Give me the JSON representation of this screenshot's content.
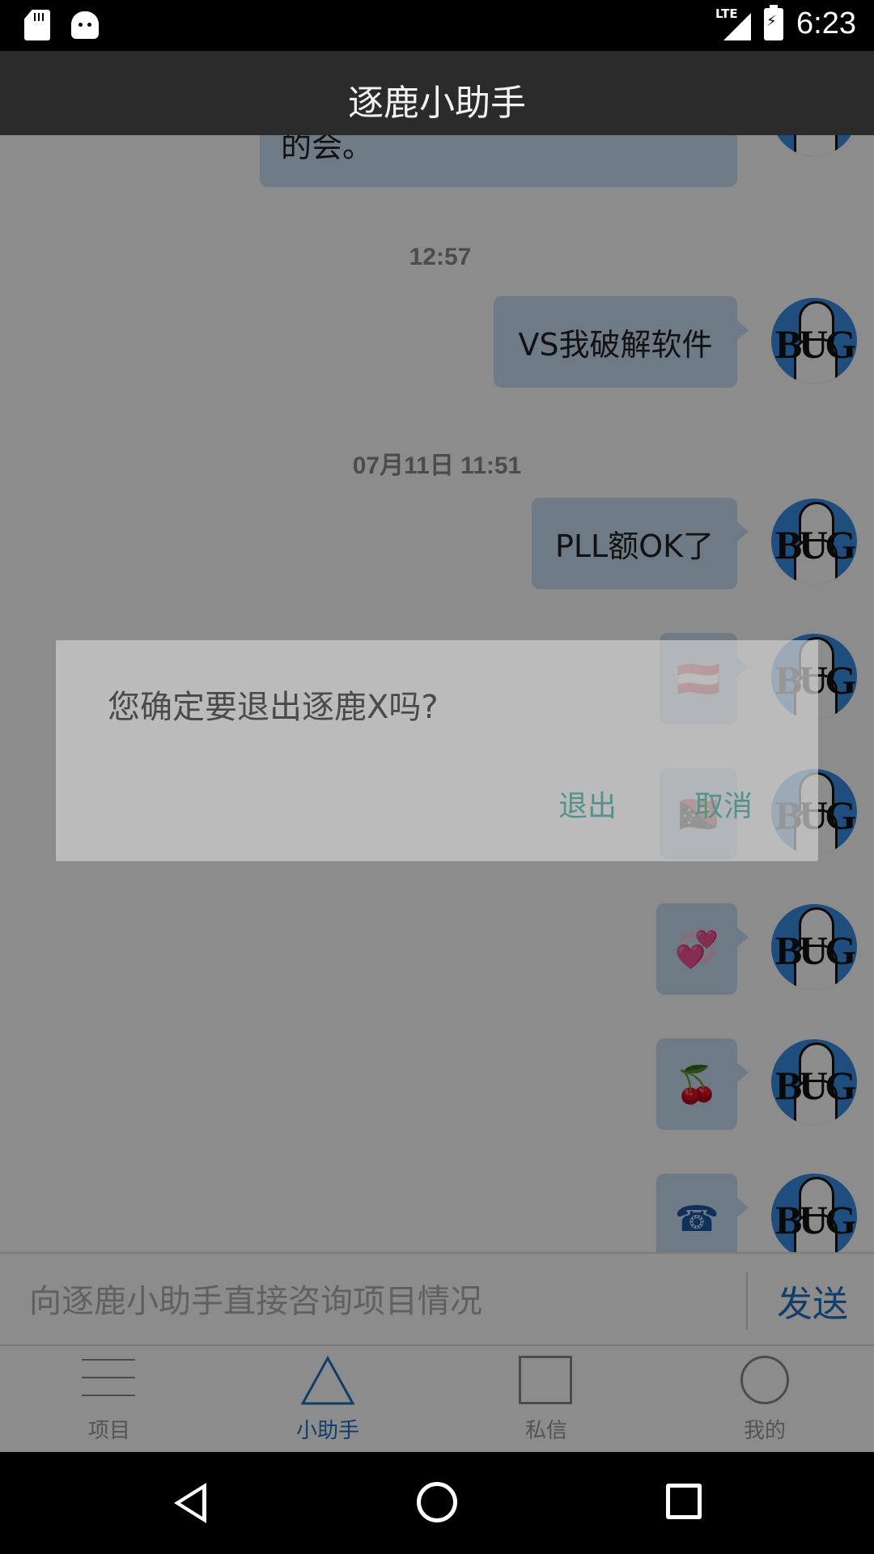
{
  "status_bar": {
    "time": "6:23",
    "network": "LTE"
  },
  "header": {
    "title": "逐鹿小助手"
  },
  "chat": {
    "partial_message": "的会。",
    "messages": [
      {
        "time": "12:57",
        "text": "VS我破解软件"
      },
      {
        "time": "07月11日 11:51",
        "text": "PLL额OK了"
      }
    ],
    "emoji_messages": [
      "🇦🇹",
      "🇵🇬",
      "💞",
      "🍒",
      "☎"
    ],
    "avatar_text": "BUG"
  },
  "input_bar": {
    "placeholder": "向逐鹿小助手直接咨询项目情况",
    "send_label": "发送"
  },
  "tabs": [
    {
      "label": "项目",
      "icon": "menu-icon"
    },
    {
      "label": "小助手",
      "icon": "triangle-icon",
      "active": true
    },
    {
      "label": "私信",
      "icon": "square-icon"
    },
    {
      "label": "我的",
      "icon": "circle-icon"
    }
  ],
  "dialog": {
    "message": "您确定要退出逐鹿X吗?",
    "confirm_label": "退出",
    "cancel_label": "取消"
  },
  "colors": {
    "accent": "#1f6fc0",
    "bubble": "#c9def5",
    "dialog_button": "#55938a"
  }
}
